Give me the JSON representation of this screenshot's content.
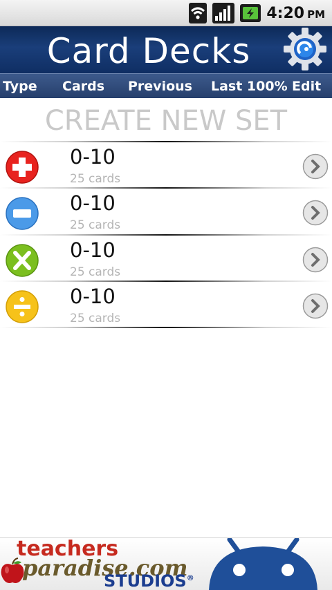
{
  "status_bar": {
    "icons": [
      "wifi-icon",
      "signal-icon",
      "battery-charging-icon"
    ],
    "time": "4:20",
    "ampm": "PM"
  },
  "title_bar": {
    "title": "Card Decks",
    "settings_icon": "gear-icon"
  },
  "columns": {
    "type": "Type",
    "cards": "Cards",
    "previous": "Previous",
    "last100": "Last 100%",
    "edit": "Edit"
  },
  "create_set": "CREATE NEW SET",
  "decks": [
    {
      "operation": "addition",
      "icon": "plus-icon",
      "color": "#e8231f",
      "name": "0-10",
      "count": "25 cards"
    },
    {
      "operation": "subtraction",
      "icon": "minus-icon",
      "color": "#4b9ae8",
      "name": "0-10",
      "count": "25 cards"
    },
    {
      "operation": "multiplication",
      "icon": "times-icon",
      "color": "#7bbf1f",
      "name": "0-10",
      "count": "25 cards"
    },
    {
      "operation": "division",
      "icon": "divide-icon",
      "color": "#f6c21a",
      "name": "0-10",
      "count": "25 cards"
    }
  ],
  "ad": {
    "line1": "teachers",
    "line2": "paradise.com",
    "line3": "STUDIOS",
    "registered": "®"
  },
  "colors": {
    "title_bar": "#12336b",
    "column_bar": "#2f4a7a",
    "create_text": "#c9c9c9"
  }
}
